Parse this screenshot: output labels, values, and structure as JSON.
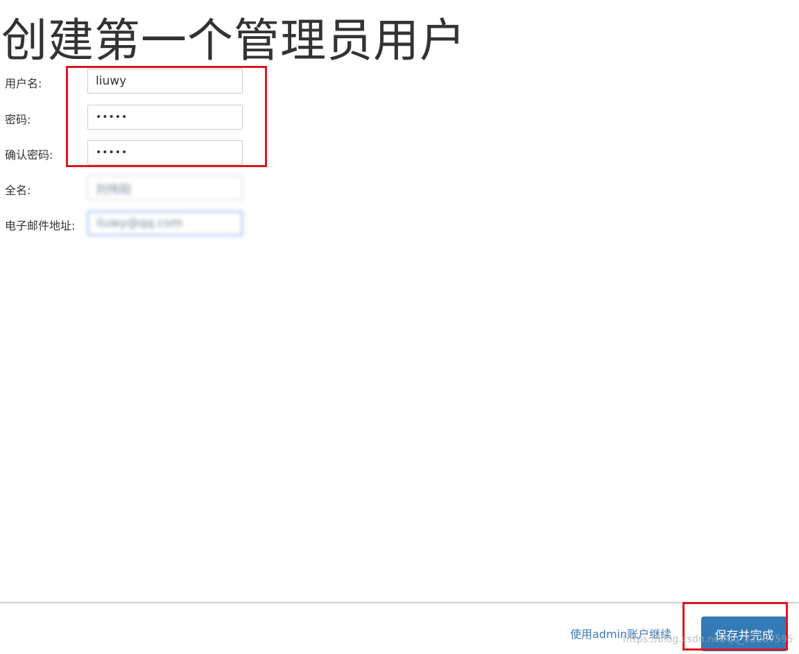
{
  "page": {
    "title": "创建第一个管理员用户"
  },
  "form": {
    "username": {
      "label": "用户名:",
      "value": "liuwy"
    },
    "password": {
      "label": "密码:",
      "value": "•••••"
    },
    "confirm_password": {
      "label": "确认密码:",
      "value": "•••••"
    },
    "full_name": {
      "label": "全名:",
      "value": "刘伟阳"
    },
    "email": {
      "label": "电子邮件地址:",
      "value": "liuwy@qq.com"
    }
  },
  "footer": {
    "continue_link": "使用admin账户继续",
    "save_button": "保存并完成",
    "watermark": "https://blog.csdn.net/qq_33267595"
  },
  "colors": {
    "highlight": "#e0141e",
    "primary_button": "#337ab7",
    "link": "#3c78b4"
  }
}
